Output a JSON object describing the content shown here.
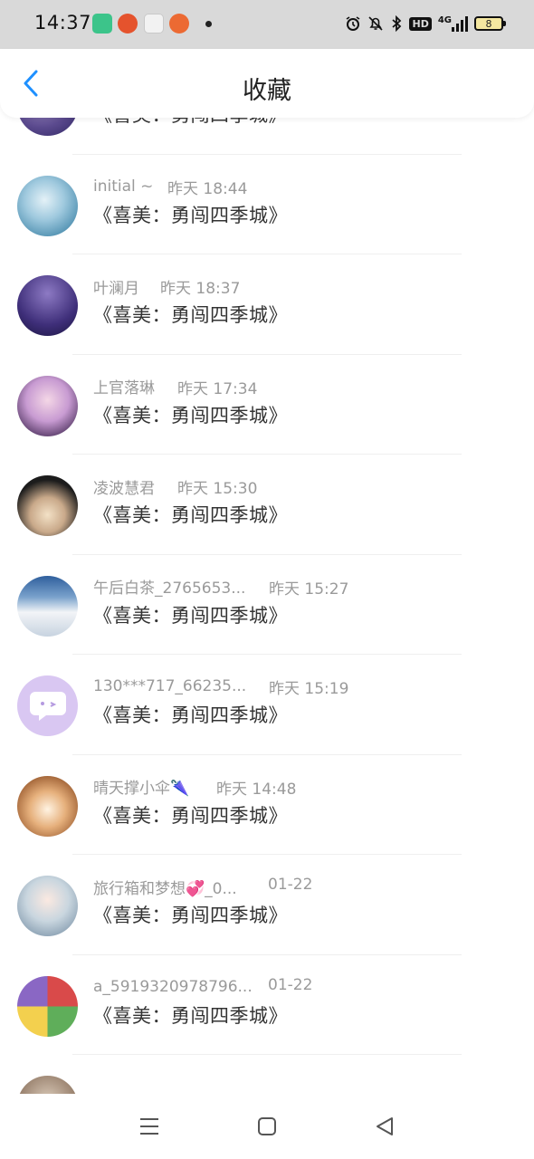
{
  "status_bar": {
    "time": "14:37",
    "network": "4G",
    "hd": "HD",
    "battery": "8"
  },
  "header": {
    "title": "收藏",
    "accent_color": "#1e90ff"
  },
  "items": [
    {
      "name": "",
      "time": "",
      "title": "《喜美：勇闯四季城》"
    },
    {
      "name": "initial ~",
      "time": "昨天 18:44",
      "title": "《喜美：勇闯四季城》"
    },
    {
      "name": "叶澜月",
      "time": "昨天 18:37",
      "title": "《喜美：勇闯四季城》"
    },
    {
      "name": "上官落琳",
      "time": "昨天 17:34",
      "title": "《喜美：勇闯四季城》"
    },
    {
      "name": "凌波慧君",
      "time": "昨天 15:30",
      "title": "《喜美：勇闯四季城》"
    },
    {
      "name": "午后白茶_2765653...",
      "time": "昨天 15:27",
      "title": "《喜美：勇闯四季城》"
    },
    {
      "name": "130***717_66235...",
      "time": "昨天 15:19",
      "title": "《喜美：勇闯四季城》"
    },
    {
      "name": "晴天撑小伞🌂",
      "time": "昨天 14:48",
      "title": "《喜美：勇闯四季城》"
    },
    {
      "name": "旅行箱和梦想💞_0...",
      "time": "01-22",
      "title": "《喜美：勇闯四季城》"
    },
    {
      "name": "a_5919320978796...",
      "time": "01-22",
      "title": "《喜美：勇闯四季城》"
    },
    {
      "name": "",
      "time": "",
      "title": ""
    }
  ],
  "icons": {
    "back": "chevron-left-icon",
    "menu": "menu-icon",
    "home": "home-square-icon",
    "back_nav": "back-triangle-icon"
  }
}
